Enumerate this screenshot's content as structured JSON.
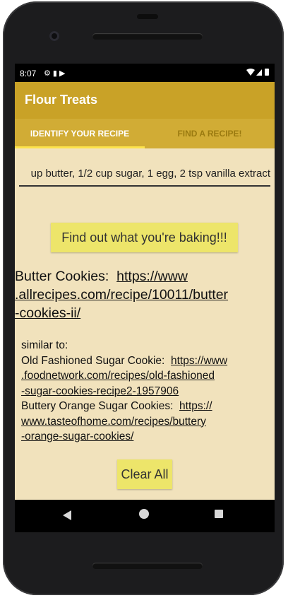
{
  "status": {
    "time": "8:07"
  },
  "app": {
    "title": "Flour Treats"
  },
  "tabs": [
    {
      "label": "IDENTIFY YOUR RECIPE",
      "selected": true
    },
    {
      "label": "FIND A RECIPE!",
      "selected": false
    }
  ],
  "input": {
    "value": "up butter, 1/2 cup sugar, 1 egg, 2 tsp vanilla extract"
  },
  "find_button": {
    "label": "Find out what you're baking!!!"
  },
  "result": {
    "name": "Butter Cookies:",
    "url_lines": [
      ".allrecipes.com/recipe/10011/butter",
      "-cookies-ii/"
    ],
    "url_first": "https://www"
  },
  "similar": {
    "intro": "similar to:",
    "items": [
      {
        "name": "Old Fashioned Sugar Cookie:",
        "url_first": "https://www",
        "url_lines": [
          ".foodnetwork.com/recipes/old-fashioned",
          "-sugar-cookies-recipe2-1957906"
        ]
      },
      {
        "name": "Buttery Orange Sugar Cookies:",
        "url_first": "https://",
        "url_lines": [
          "www.tasteofhome.com/recipes/buttery",
          "-orange-sugar-cookies/"
        ]
      }
    ]
  },
  "clear_button": {
    "label": "Clear All"
  },
  "colors": {
    "appbar": "#c9a227",
    "tabbar": "#d1ac35",
    "background": "#f1e2bc",
    "button": "#ede56a",
    "tab_indicator": "#fde34a"
  }
}
